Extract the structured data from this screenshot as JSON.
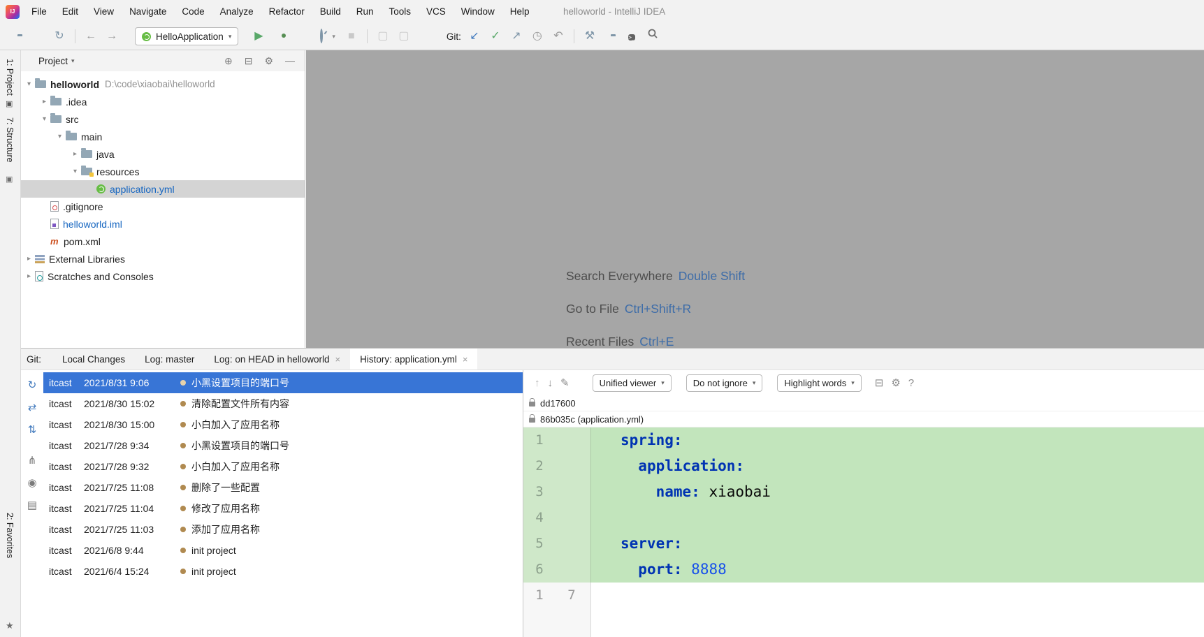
{
  "window_title": "helloworld - IntelliJ IDEA",
  "menu_items": [
    "File",
    "Edit",
    "View",
    "Navigate",
    "Code",
    "Analyze",
    "Refactor",
    "Build",
    "Run",
    "Tools",
    "VCS",
    "Window",
    "Help"
  ],
  "toolbar": {
    "run_config": "HelloApplication",
    "git_label": "Git:"
  },
  "side_strip": {
    "project": "1: Project",
    "structure": "7: Structure",
    "favorites": "2: Favorites"
  },
  "project_panel": {
    "title": "Project",
    "tree": [
      {
        "level": 0,
        "caret": "down",
        "icon": "folder-project",
        "label": "helloworld",
        "suffix": "D:\\code\\xiaobai\\helloworld",
        "bold": true,
        "selected": false,
        "modified": false
      },
      {
        "level": 1,
        "caret": "right",
        "icon": "folder",
        "label": ".idea",
        "suffix": "",
        "bold": false,
        "selected": false,
        "modified": false
      },
      {
        "level": 1,
        "caret": "down",
        "icon": "folder",
        "label": "src",
        "suffix": "",
        "bold": false,
        "selected": false,
        "modified": false
      },
      {
        "level": 2,
        "caret": "down",
        "icon": "folder",
        "label": "main",
        "suffix": "",
        "bold": false,
        "selected": false,
        "modified": false
      },
      {
        "level": 3,
        "caret": "right",
        "icon": "folder",
        "label": "java",
        "suffix": "",
        "bold": false,
        "selected": false,
        "modified": false
      },
      {
        "level": 3,
        "caret": "down",
        "icon": "folder-res",
        "label": "resources",
        "suffix": "",
        "bold": false,
        "selected": false,
        "modified": false
      },
      {
        "level": 4,
        "caret": "none",
        "icon": "yml",
        "label": "application.yml",
        "suffix": "",
        "bold": false,
        "selected": true,
        "modified": true
      },
      {
        "level": 1,
        "caret": "none",
        "icon": "file-git",
        "label": ".gitignore",
        "suffix": "",
        "bold": false,
        "selected": false,
        "modified": false
      },
      {
        "level": 1,
        "caret": "none",
        "icon": "file-iml",
        "label": "helloworld.iml",
        "suffix": "",
        "bold": false,
        "selected": false,
        "modified": true
      },
      {
        "level": 1,
        "caret": "none",
        "icon": "maven",
        "label": "pom.xml",
        "suffix": "",
        "bold": false,
        "selected": false,
        "modified": false
      },
      {
        "level": 0,
        "caret": "right",
        "icon": "lib",
        "label": "External Libraries",
        "suffix": "",
        "bold": false,
        "selected": false,
        "modified": false
      },
      {
        "level": 0,
        "caret": "right",
        "icon": "scratch",
        "label": "Scratches and Consoles",
        "suffix": "",
        "bold": false,
        "selected": false,
        "modified": false
      }
    ]
  },
  "editor_hints": [
    {
      "label": "Search Everywhere",
      "shortcut": "Double Shift"
    },
    {
      "label": "Go to File",
      "shortcut": "Ctrl+Shift+R"
    },
    {
      "label": "Recent Files",
      "shortcut": "Ctrl+E"
    }
  ],
  "git_panel": {
    "label": "Git:",
    "tabs": [
      {
        "label": "Local Changes",
        "closable": false,
        "active": false
      },
      {
        "label": "Log: master",
        "closable": false,
        "active": false
      },
      {
        "label": "Log: on HEAD in helloworld",
        "closable": true,
        "active": false
      },
      {
        "label": "History: application.yml",
        "closable": true,
        "active": true
      }
    ],
    "strip_icons": [
      {
        "name": "refresh-icon",
        "glyph": "↻",
        "cls": "blue"
      },
      {
        "name": "compare-branches-icon",
        "glyph": "⇄",
        "cls": "blue"
      },
      {
        "name": "compare-revisions-icon",
        "glyph": "⇅",
        "cls": "blue"
      },
      {
        "name": "branch-icon",
        "glyph": "⋔",
        "cls": "sp"
      },
      {
        "name": "preview-diff-eye-icon",
        "glyph": "◉",
        "cls": ""
      },
      {
        "name": "show-in-editor-icon",
        "glyph": "▤",
        "cls": ""
      }
    ],
    "commits": [
      {
        "author": "itcast",
        "date": "2021/8/31 9:06",
        "message": "小黑设置项目的端口号",
        "selected": true
      },
      {
        "author": "itcast",
        "date": "2021/8/30 15:02",
        "message": "清除配置文件所有内容",
        "selected": false
      },
      {
        "author": "itcast",
        "date": "2021/8/30 15:00",
        "message": "小白加入了应用名称",
        "selected": false
      },
      {
        "author": "itcast",
        "date": "2021/7/28 9:34",
        "message": "小黑设置项目的端口号",
        "selected": false
      },
      {
        "author": "itcast",
        "date": "2021/7/28 9:32",
        "message": "小白加入了应用名称",
        "selected": false
      },
      {
        "author": "itcast",
        "date": "2021/7/25 11:08",
        "message": "删除了一些配置",
        "selected": false
      },
      {
        "author": "itcast",
        "date": "2021/7/25 11:04",
        "message": "修改了应用名称",
        "selected": false
      },
      {
        "author": "itcast",
        "date": "2021/7/25 11:03",
        "message": "添加了应用名称",
        "selected": false
      },
      {
        "author": "itcast",
        "date": "2021/6/8 9:44",
        "message": "init project",
        "selected": false
      },
      {
        "author": "itcast",
        "date": "2021/6/4 15:24",
        "message": "init project",
        "selected": false
      }
    ]
  },
  "diff": {
    "toolbar": {
      "viewer": "Unified viewer",
      "ignore": "Do not ignore",
      "highlight": "Highlight words"
    },
    "revisions": [
      "dd17600",
      "86b035c (application.yml)"
    ],
    "lines": [
      {
        "n1": "1",
        "n2": "",
        "added": true,
        "tokens": [
          {
            "t": "spring:",
            "s": "key"
          }
        ]
      },
      {
        "n1": "2",
        "n2": "",
        "added": true,
        "tokens": [
          {
            "t": "  ",
            "s": "plain"
          },
          {
            "t": "application:",
            "s": "key"
          }
        ]
      },
      {
        "n1": "3",
        "n2": "",
        "added": true,
        "tokens": [
          {
            "t": "    ",
            "s": "plain"
          },
          {
            "t": "name:",
            "s": "key"
          },
          {
            "t": " xiaobai",
            "s": "plain"
          }
        ]
      },
      {
        "n1": "4",
        "n2": "",
        "added": true,
        "tokens": []
      },
      {
        "n1": "5",
        "n2": "",
        "added": true,
        "tokens": [
          {
            "t": "server:",
            "s": "key"
          }
        ]
      },
      {
        "n1": "6",
        "n2": "",
        "added": true,
        "tokens": [
          {
            "t": "  ",
            "s": "plain"
          },
          {
            "t": "port:",
            "s": "key"
          },
          {
            "t": " ",
            "s": "plain"
          },
          {
            "t": "8888",
            "s": "number"
          }
        ]
      },
      {
        "n1": "1",
        "n2": "7",
        "added": false,
        "tokens": []
      }
    ]
  },
  "glyphs": {
    "caret-down": "▾",
    "caret-right": "▸",
    "combo-caret": "▾",
    "close": "×",
    "sync": "↻",
    "back": "←",
    "forward": "→",
    "run": "▶",
    "stop": "■",
    "update": "↙",
    "check": "✓",
    "push": "↗",
    "history": "◷",
    "rollback": "↶",
    "wrench": "⚒",
    "gear": "⚙",
    "up": "↑",
    "down": "↓",
    "pencil": "✎",
    "help": "?",
    "locate": "⊕",
    "collapse": "⊟",
    "minus": "—",
    "tool-window": "▣",
    "star": "★",
    "terminal": ">_",
    "disabled-a": "▢",
    "disabled-b": "▢",
    "logo": "IJ"
  },
  "colors": {
    "selection_blue": "#3875d6",
    "added_line_green": "#c2e5bc",
    "yaml_key_blue": "#0033b3",
    "number_blue": "#1750eb",
    "modified_file_blue": "#1565c0",
    "run_green": "#59a869",
    "commit_dot_tan": "#b08a50",
    "shortcut_blue": "#3d6ca8"
  }
}
